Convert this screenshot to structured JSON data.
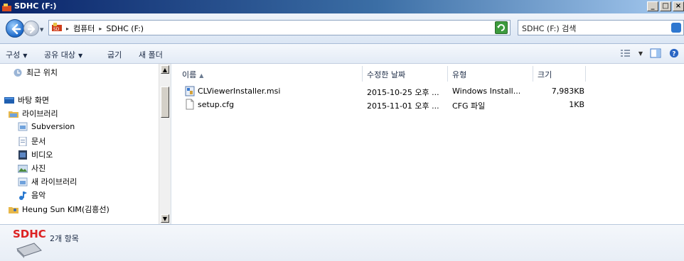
{
  "window": {
    "title": "SDHC (F:)",
    "buttons": [
      "_",
      "□",
      "×"
    ]
  },
  "address": {
    "drive_icon": "drive-icon",
    "crumbs": [
      "컴퓨터",
      "SDHC (F:)"
    ],
    "search_placeholder": "SDHC (F:) 검색"
  },
  "toolbar": {
    "organize": "구성",
    "share": "공유 대상",
    "burn": "굽기",
    "new_folder": "새 폴더"
  },
  "nav": {
    "items": [
      {
        "label": "최근 위치",
        "icon": "recent-places-icon"
      },
      {
        "label": "바탕 화면",
        "icon": "desktop-icon"
      },
      {
        "label": "라이브러리",
        "icon": "library-icon"
      },
      {
        "label": "Subversion",
        "icon": "library-folder-icon"
      },
      {
        "label": "문서",
        "icon": "documents-icon"
      },
      {
        "label": "비디오",
        "icon": "video-icon"
      },
      {
        "label": "사진",
        "icon": "pictures-icon"
      },
      {
        "label": "새 라이브러리",
        "icon": "library-folder-icon"
      },
      {
        "label": "음악",
        "icon": "music-icon"
      },
      {
        "label": "Heung Sun KIM(김흥선)",
        "icon": "user-folder-icon"
      }
    ]
  },
  "columns": {
    "name": "이름",
    "modified": "수정한 날짜",
    "type": "유형",
    "size": "크기"
  },
  "files": [
    {
      "name": "CLViewerInstaller.msi",
      "modified": "2015-10-25 오후 ...",
      "type": "Windows Install...",
      "size": "7,983KB",
      "icon": "msi-installer-icon"
    },
    {
      "name": "setup.cfg",
      "modified": "2015-11-01 오후 ...",
      "type": "CFG 파일",
      "size": "1KB",
      "icon": "cfg-file-icon"
    }
  ],
  "details": {
    "logo_text": "SDHC",
    "item_count": "2개 항목"
  },
  "colors": {
    "title_gradient_start": "#0a246a",
    "title_gradient_end": "#a6caf0",
    "nav_accent": "#1c69c9"
  }
}
